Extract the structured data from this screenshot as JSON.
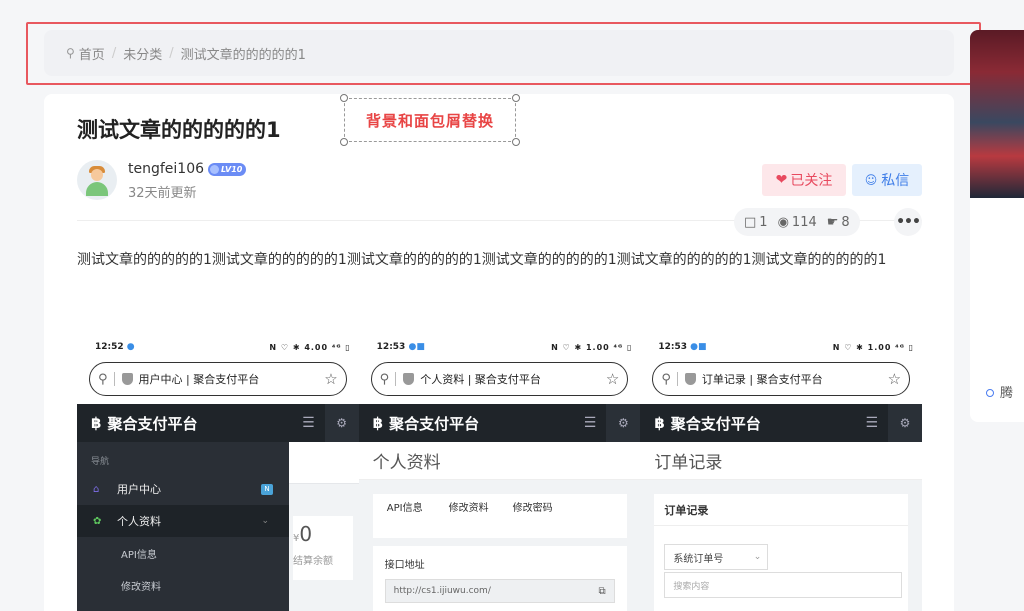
{
  "breadcrumb": {
    "pin_icon": "map-pin-icon",
    "items": [
      "首页",
      "未分类",
      "测试文章的的的的的1"
    ],
    "separator": "/"
  },
  "side": {
    "text": "腾"
  },
  "article": {
    "title": "测试文章的的的的的1",
    "annotation": "背景和面包屑替换",
    "author": {
      "name": "tengfei106",
      "level": "LV10",
      "updated": "32天前更新"
    },
    "follow_label": "已关注",
    "message_label": "私信",
    "stats": {
      "comments": "1",
      "views": "114",
      "likes": "8"
    },
    "more_label": "•••",
    "body": "测试文章的的的的的1测试文章的的的的的1测试文章的的的的的1测试文章的的的的的1测试文章的的的的的1测试文章的的的的的1"
  },
  "screenshots": [
    {
      "time": "12:52",
      "status_icons": "N ♡ ✱ 4.00 ⁴ᴳ ▯",
      "url_title": "用户中心 | 聚合支付平台",
      "app_title": "聚合支付平台",
      "nav_label": "导航",
      "menu": [
        {
          "label": "用户中心",
          "badge": "N"
        },
        {
          "label": "个人资料"
        }
      ],
      "submenu": [
        "API信息",
        "修改资料"
      ],
      "balance_value": "0",
      "balance_currency": "¥",
      "balance_label": "结算余额"
    },
    {
      "time": "12:53",
      "status_icons": "N ♡ ✱ 1.00 ⁴ᴳ ▯",
      "url_title": "个人资料 | 聚合支付平台",
      "app_title": "聚合支付平台",
      "page_title": "个人资料",
      "tabs": [
        "API信息",
        "修改资料",
        "修改密码"
      ],
      "field_label": "接口地址",
      "field_value": "http://cs1.ijiuwu.com/"
    },
    {
      "time": "12:53",
      "status_icons": "N ♡ ✱ 1.00 ⁴ᴳ ▯",
      "url_title": "订单记录 | 聚合支付平台",
      "app_title": "聚合支付平台",
      "page_title": "订单记录",
      "box_title": "订单记录",
      "select_value": "系统订单号",
      "search_placeholder": "搜索内容"
    }
  ],
  "colors": {
    "accent_red": "#e84a5f",
    "accent_blue": "#3f7ee8",
    "outline_red": "#e8585f",
    "app_header": "#1f2429"
  }
}
